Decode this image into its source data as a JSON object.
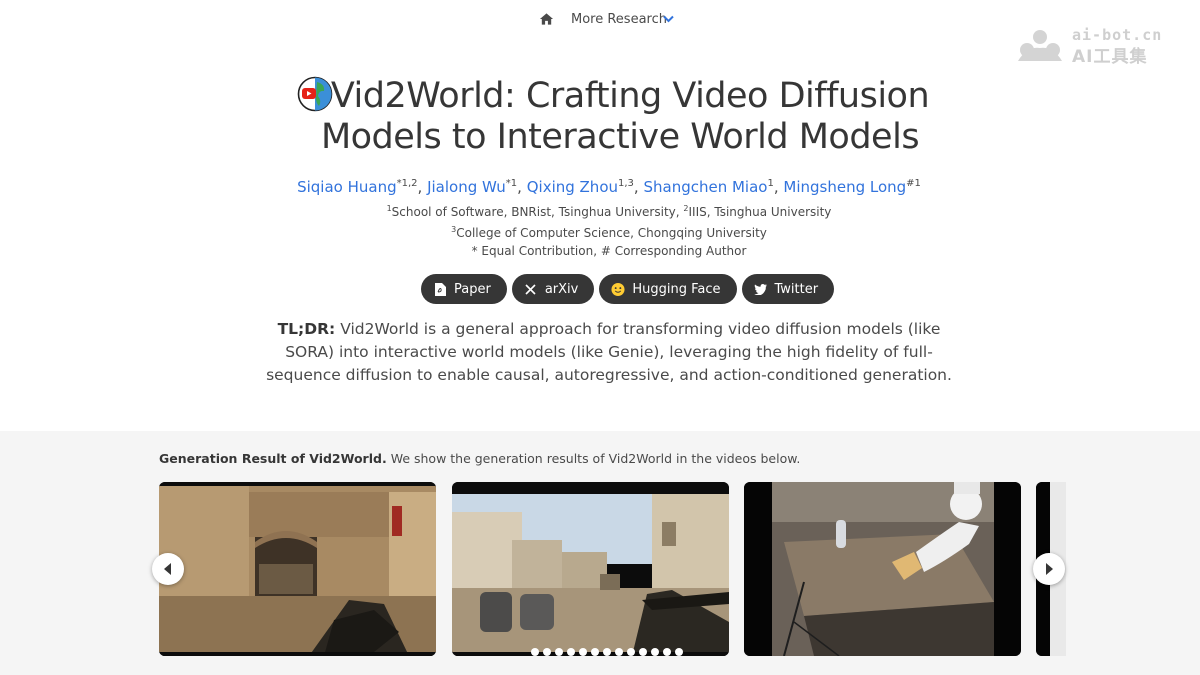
{
  "nav": {
    "home_icon": "home-icon",
    "more_research": "More Research",
    "chevron_icon": "chevron-down-icon"
  },
  "watermark": {
    "top": "ai-bot.cn",
    "bottom": "AI工具集"
  },
  "title": {
    "icon": "globe-youtube-icon",
    "line1": "Vid2World: Crafting Video Diffusion",
    "line2": "Models to Interactive World Models"
  },
  "authors": [
    {
      "name": "Siqiao Huang",
      "marks": "*1,2"
    },
    {
      "name": "Jialong Wu",
      "marks": "*1"
    },
    {
      "name": "Qixing Zhou",
      "marks": "1,3"
    },
    {
      "name": "Shangchen Miao",
      "marks": "1"
    },
    {
      "name": "Mingsheng Long",
      "marks": "#1"
    }
  ],
  "affiliations": {
    "a1_sup": "1",
    "a1": "School of Software, BNRist, Tsinghua University, ",
    "a2_sup": "2",
    "a2": "IIIS, Tsinghua University",
    "a3_sup": "3",
    "a3": "College of Computer Science, Chongqing University",
    "note": "* Equal Contribution, # Corresponding Author"
  },
  "buttons": [
    {
      "label": "Paper",
      "icon": "pdf-icon"
    },
    {
      "label": "arXiv",
      "icon": "x-icon"
    },
    {
      "label": "Hugging Face",
      "icon": "hugging-face-icon"
    },
    {
      "label": "Twitter",
      "icon": "twitter-icon"
    }
  ],
  "tldr": {
    "label": "TL;DR:",
    "text": " Vid2World is a general approach for transforming video diffusion models (like SORA) into interactive world models (like Genie), leveraging the high fidelity of full-sequence diffusion to enable causal, autoregressive, and action-conditioned generation."
  },
  "gallery": {
    "caption_bold": "Generation Result of Vid2World.",
    "caption": " We show the generation results of Vid2World in the videos below.",
    "dot_count": 13
  },
  "colors": {
    "link": "#3273dc",
    "button_bg": "#363636",
    "section_bg": "#f5f5f5"
  }
}
